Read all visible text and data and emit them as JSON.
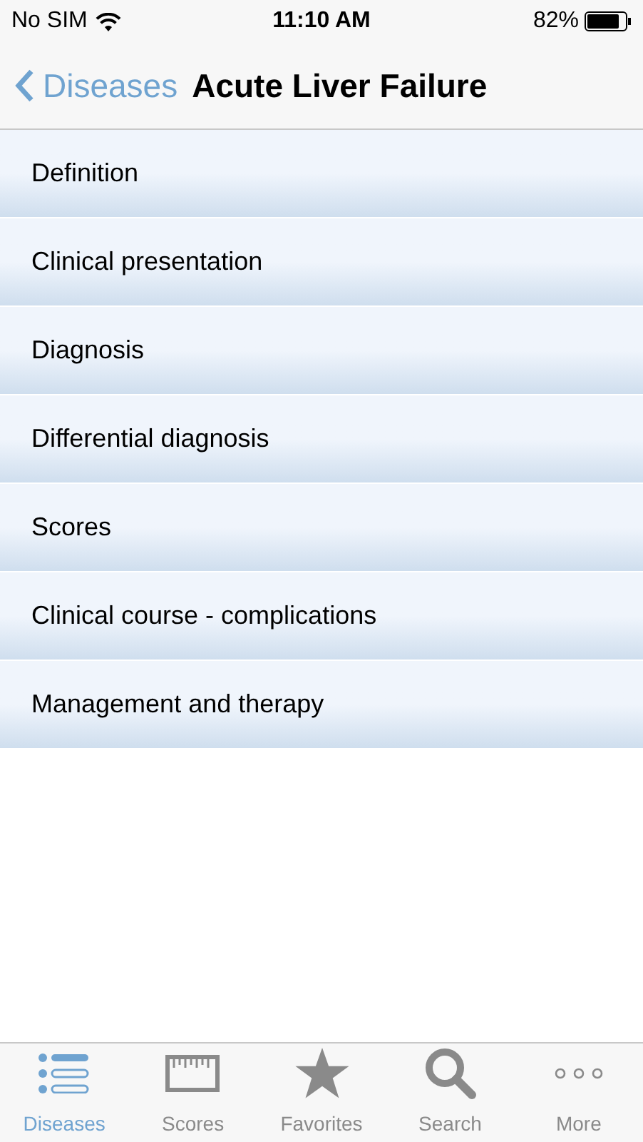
{
  "status_bar": {
    "carrier": "No SIM",
    "time": "11:10 AM",
    "battery": "82%"
  },
  "nav": {
    "back": "Diseases",
    "title": "Acute Liver Failure"
  },
  "sections": [
    "Definition",
    "Clinical presentation",
    "Diagnosis",
    "Differential diagnosis",
    "Scores",
    "Clinical course - complications",
    "Management and therapy"
  ],
  "tabs": [
    {
      "label": "Diseases",
      "kind": "list",
      "selected": true
    },
    {
      "label": "Scores",
      "kind": "ruler",
      "selected": false
    },
    {
      "label": "Favorites",
      "kind": "star",
      "selected": false
    },
    {
      "label": "Search",
      "kind": "search",
      "selected": false
    },
    {
      "label": "More",
      "kind": "more",
      "selected": false
    }
  ]
}
